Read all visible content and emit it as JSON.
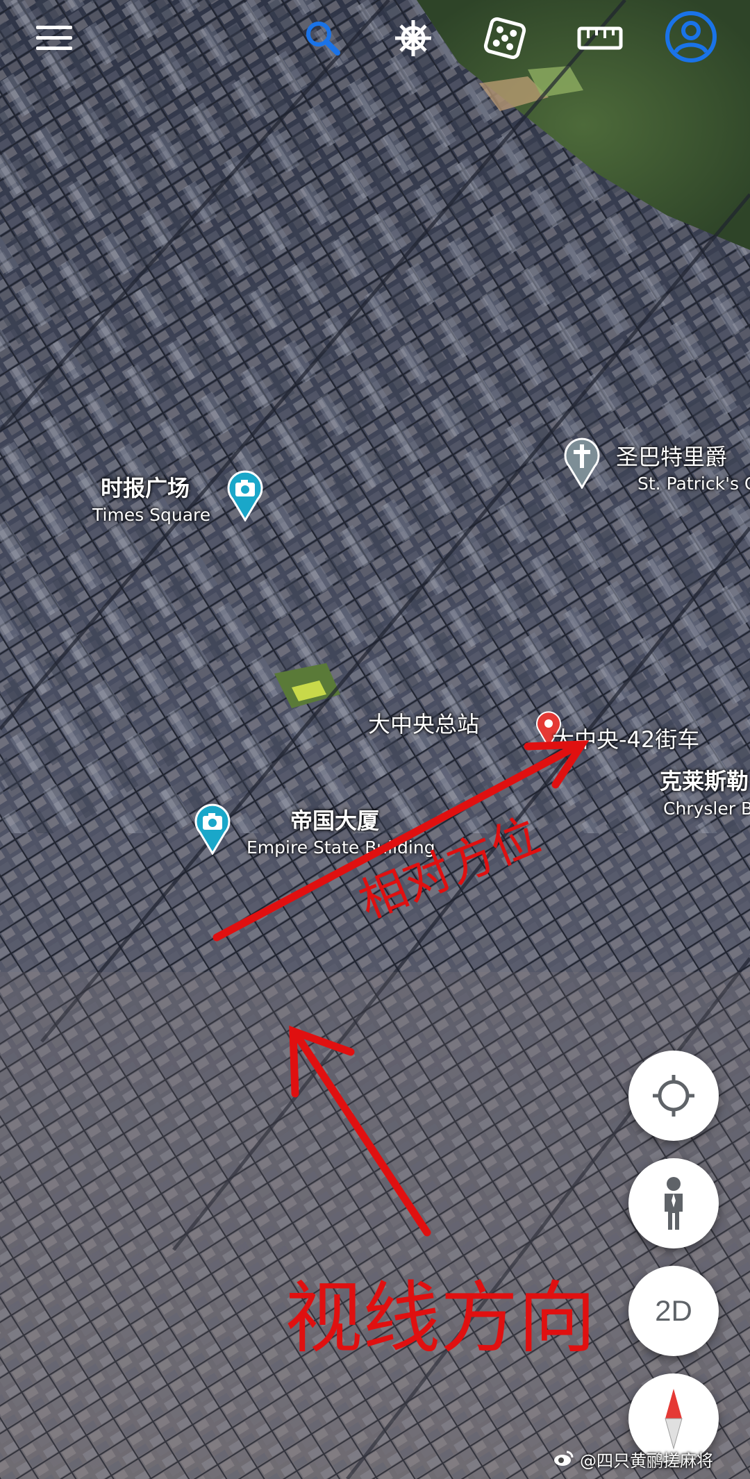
{
  "toolbar": {
    "menu_icon": "menu-icon",
    "search_icon": "search-icon",
    "voyager_icon": "ship-wheel-icon",
    "feeling_lucky_icon": "dice-icon",
    "measure_icon": "ruler-icon",
    "account_icon": "account-circle-icon",
    "accent_color": "#1a73e8"
  },
  "places": {
    "times_square": {
      "name_cn": "时报广场",
      "name_en": "Times Square",
      "icon": "camera-pin-icon"
    },
    "st_patricks": {
      "name_cn": "圣巴特里爵",
      "name_en": "St. Patrick's C",
      "icon": "church-cross-pin-icon"
    },
    "grand_central": {
      "name_cn": "大中央总站"
    },
    "grand_central_42": {
      "name_cn": "大中央-42街车",
      "icon": "red-location-pin-icon"
    },
    "chrysler": {
      "name_cn": "克莱斯勒",
      "name_en": "Chrysler B"
    },
    "empire_state": {
      "name_cn": "帝国大厦",
      "name_en": "Empire State Building",
      "icon": "camera-pin-icon"
    }
  },
  "annotations": {
    "relative_direction": "相对方位",
    "line_of_sight": "视线方向",
    "arrow_color": "#e01010"
  },
  "controls": {
    "locate_icon": "crosshair-icon",
    "street_view_icon": "pegman-icon",
    "view_mode_label": "2D",
    "compass_icon": "compass-icon"
  },
  "watermark": {
    "logo": "weibo-logo-icon",
    "text": "@四只黄鹂搓麻将"
  }
}
